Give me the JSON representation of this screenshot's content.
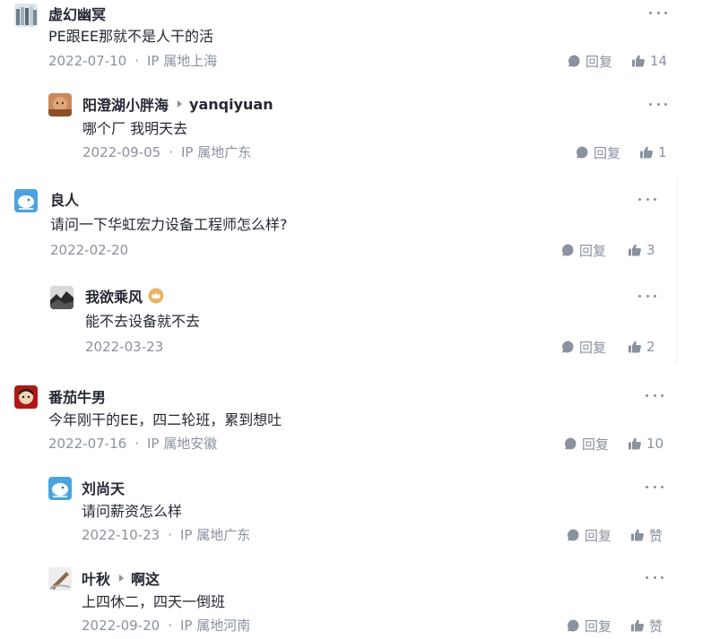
{
  "comments": [
    {
      "name": "虚幻幽冥",
      "content": "PE跟EE那就不是人干的活",
      "date": "2022-07-10",
      "ip": "IP 属地上海",
      "reply_label": "回复",
      "like_label": "14"
    },
    {
      "name": "阳澄湖小胖海",
      "reply_to": "yanqiyuan",
      "content": "哪个厂 我明天去",
      "date": "2022-09-05",
      "ip": "IP 属地广东",
      "reply_label": "回复",
      "like_label": "1"
    },
    {
      "name": "良人",
      "content": "请问一下华虹宏力设备工程师怎么样?",
      "date": "2022-02-20",
      "reply_label": "回复",
      "like_label": "3"
    },
    {
      "name": "我欲乘风",
      "content": "能不去设备就不去",
      "date": "2022-03-23",
      "reply_label": "回复",
      "like_label": "2"
    },
    {
      "name": "番茄牛男",
      "content": "今年刚干的EE，四二轮班，累到想吐",
      "date": "2022-07-16",
      "ip": "IP 属地安徽",
      "reply_label": "回复",
      "like_label": "10"
    },
    {
      "name": "刘尚天",
      "content": "请问薪资怎么样",
      "date": "2022-10-23",
      "ip": "IP 属地广东",
      "reply_label": "回复",
      "like_label": "赞"
    },
    {
      "name": "叶秋",
      "reply_to": "啊这",
      "content": "上四休二，四天一倒班",
      "date": "2022-09-20",
      "ip": "IP 属地河南",
      "reply_label": "回复",
      "like_label": "赞"
    }
  ],
  "meta_separator": "·",
  "icons": {
    "reply": "comment-bubble-icon",
    "like": "thumbs-up-icon",
    "more": "more-dots-icon",
    "reply_to": "caret-right-icon",
    "badge": "crown-badge-icon"
  },
  "colors": {
    "text": "#252933",
    "muted": "#8a919f",
    "badge": "#e8b56b"
  }
}
